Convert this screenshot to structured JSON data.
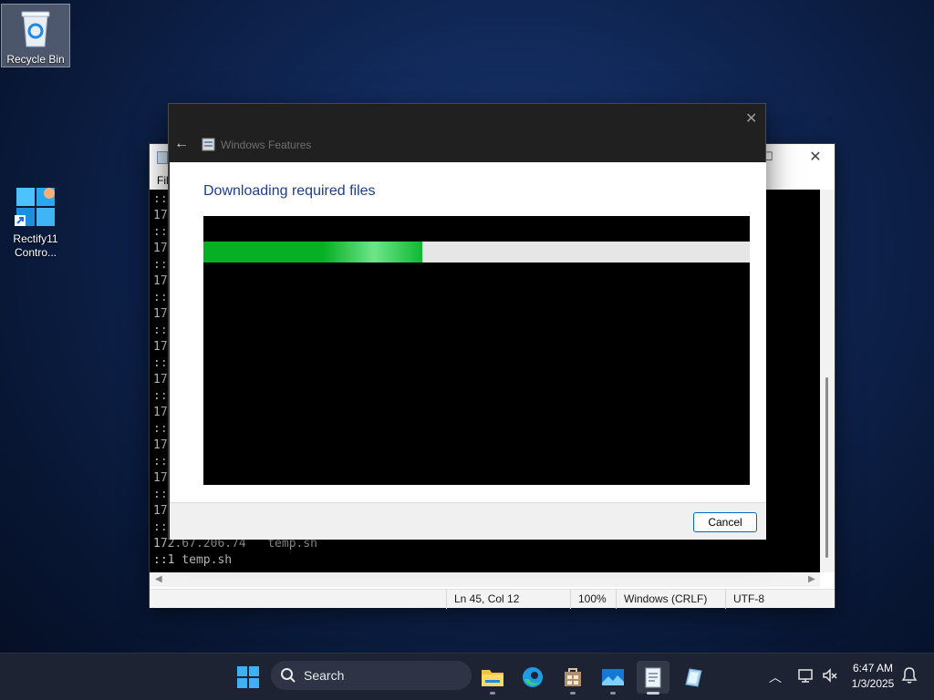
{
  "desktop": {
    "icons": [
      {
        "label": "Recycle Bin"
      },
      {
        "label": "Rectify11\nContro..."
      }
    ]
  },
  "notepad": {
    "menu_first": "Fil",
    "editor_lines": [
      "::",
      "17",
      "::",
      "17",
      "::",
      "17",
      "::",
      "17",
      "::",
      "17",
      "::",
      "17",
      "::",
      "17",
      "::",
      "17",
      "::",
      "17",
      "::",
      "17",
      "::",
      "172.67.206.74   temp.sh",
      "::1 temp.sh"
    ],
    "status": {
      "position": "Ln 45, Col 12",
      "zoom": "100%",
      "line_ending": "Windows (CRLF)",
      "encoding": "UTF-8"
    }
  },
  "dialog": {
    "title": "Windows Features",
    "heading": "Downloading required files",
    "progress_fraction": 0.4,
    "cancel_label": "Cancel"
  },
  "taskbar": {
    "search_label": "Search",
    "apps": [
      "file-explorer",
      "edge",
      "store",
      "photos",
      "notepad",
      "rectify-control"
    ],
    "clock_time": "6:47 AM",
    "clock_date": "1/3/2025"
  },
  "colors": {
    "progress_green": "#06b025",
    "dialog_heading": "#1e3d8c",
    "taskbar_bg": "#1d2333"
  }
}
